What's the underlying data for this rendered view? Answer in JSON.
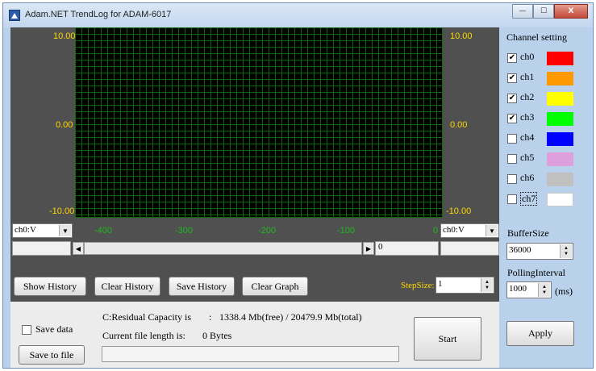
{
  "window": {
    "title": "Adam.NET TrendLog for ADAM-6017",
    "min_glyph": "—",
    "max_glyph": "☐",
    "close_glyph": "X"
  },
  "chart": {
    "y_top": "10.00",
    "y_mid": "0.00",
    "y_bottom": "-10.00",
    "x_ticks": [
      "-400",
      "-300",
      "-200",
      "-100",
      "0"
    ],
    "grid_color": "#0c6b0c",
    "background": "#000000"
  },
  "left_channel_select": "ch0:V",
  "right_channel_select": "ch0:V",
  "dropdown_glyph": "▼",
  "scrollbar": {
    "left_arrow": "◀",
    "right_arrow": "▶",
    "value": "0"
  },
  "buttons": {
    "show_history": "Show History",
    "clear_history": "Clear History",
    "save_history": "Save History",
    "clear_graph": "Clear Graph",
    "start": "Start",
    "apply": "Apply",
    "save_to_file": "Save to file"
  },
  "step": {
    "label": "StepSize:",
    "value": "1"
  },
  "save_data_label": "Save data",
  "capacity": {
    "label": "C:Residual Capacity is",
    "sep": ":",
    "value": "1338.4 Mb(free) / 20479.9 Mb(total)"
  },
  "file_length": {
    "label": "Current file length is:",
    "value": "0 Bytes"
  },
  "right_panel": {
    "channel_setting_label": "Channel setting",
    "channels": [
      {
        "name": "ch0",
        "checked": true,
        "check": "✔",
        "color": "#ff0000"
      },
      {
        "name": "ch1",
        "checked": true,
        "check": "✔",
        "color": "#ff9900"
      },
      {
        "name": "ch2",
        "checked": true,
        "check": "✔",
        "color": "#ffff00"
      },
      {
        "name": "ch3",
        "checked": true,
        "check": "✔",
        "color": "#00ff00"
      },
      {
        "name": "ch4",
        "checked": false,
        "check": "",
        "color": "#0000ff"
      },
      {
        "name": "ch5",
        "checked": false,
        "check": "",
        "color": "#dda0dd"
      },
      {
        "name": "ch6",
        "checked": false,
        "check": "",
        "color": "#c0c0c0"
      },
      {
        "name": "ch7",
        "checked": false,
        "check": "",
        "color": "#ffffff"
      }
    ],
    "buffer_label": "BufferSize",
    "buffer_value": "36000",
    "polling_label": "PollingInterval",
    "polling_value": "1000",
    "polling_unit": "(ms)"
  },
  "spin_up": "▲",
  "spin_down": "▼"
}
